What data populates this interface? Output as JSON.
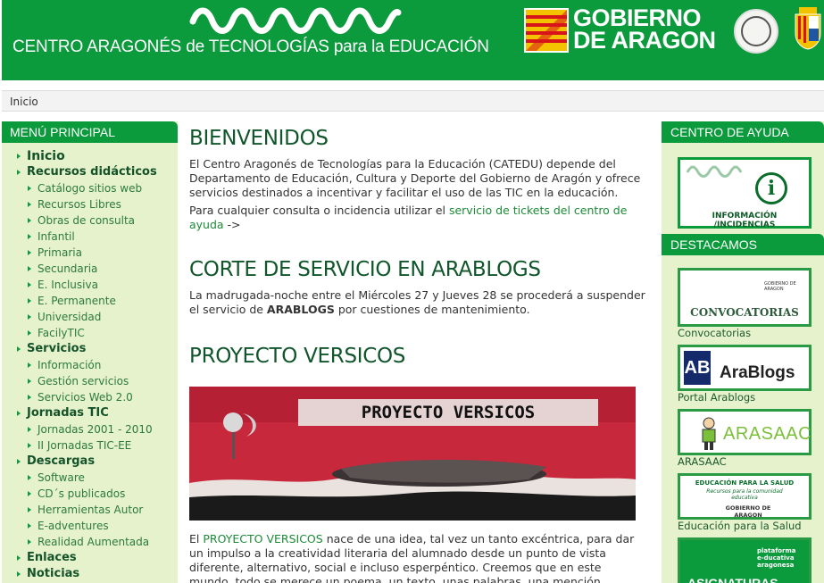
{
  "header": {
    "site_title": "CENTRO ARAGONÉS de TECNOLOGÍAS para la EDUCACIÓN",
    "gov_line1": "GOBIERNO",
    "gov_line2": "DE ARAGON"
  },
  "breadcrumb": "Inicio",
  "left_menu": {
    "title": "MENÚ PRINCIPAL",
    "items": [
      {
        "label": "Inicio",
        "level": "top"
      },
      {
        "label": "Recursos didácticos",
        "level": "top"
      },
      {
        "label": "Catálogo sitios web",
        "level": "sub"
      },
      {
        "label": "Recursos Libres",
        "level": "sub"
      },
      {
        "label": "Obras de consulta",
        "level": "sub"
      },
      {
        "label": "Infantil",
        "level": "sub"
      },
      {
        "label": "Primaria",
        "level": "sub"
      },
      {
        "label": "Secundaria",
        "level": "sub"
      },
      {
        "label": "E. Inclusiva",
        "level": "sub"
      },
      {
        "label": "E. Permanente",
        "level": "sub"
      },
      {
        "label": "Universidad",
        "level": "sub"
      },
      {
        "label": "FacilyTIC",
        "level": "sub"
      },
      {
        "label": "Servicios",
        "level": "top"
      },
      {
        "label": "Información",
        "level": "sub"
      },
      {
        "label": "Gestión servicios",
        "level": "sub"
      },
      {
        "label": "Servicios Web 2.0",
        "level": "sub"
      },
      {
        "label": "Jornadas TIC",
        "level": "top"
      },
      {
        "label": "Jornadas 2001 - 2010",
        "level": "sub"
      },
      {
        "label": "II Jornadas TIC-EE",
        "level": "sub"
      },
      {
        "label": "Descargas",
        "level": "top"
      },
      {
        "label": "Software",
        "level": "sub"
      },
      {
        "label": "CD´s publicados",
        "level": "sub"
      },
      {
        "label": "Herramientas Autor",
        "level": "sub"
      },
      {
        "label": "E-adventures",
        "level": "sub"
      },
      {
        "label": "Realidad Aumentada",
        "level": "sub"
      },
      {
        "label": "Enlaces",
        "level": "top"
      },
      {
        "label": "Noticias",
        "level": "top"
      }
    ]
  },
  "main": {
    "welcome": {
      "title": "BIENVENIDOS",
      "p1": "El Centro Aragonés de Tecnologías para la Educación (CATEDU) depende del Departamento de Educación, Cultura y Deporte del Gobierno de Aragón y ofrece servicios destinados a incentivar y facilitar el uso de las TIC en la educación.",
      "p2_pre": "Para cualquier consulta o incidencia utilizar el ",
      "p2_link": "servicio de tickets del centro de ayuda",
      "p2_post": " ->"
    },
    "arablogs": {
      "title": "CORTE DE SERVICIO EN ARABLOGS",
      "p_pre": "La madrugada-noche entre el Miércoles 27 y Jueves 28 se procederá a suspender el servicio de ",
      "p_bold": "ARABLOGS",
      "p_post": " por cuestiones de mantenimiento."
    },
    "versicos": {
      "title": "PROYECTO VERSICOS",
      "image_text": "PROYECTO VERSICOS",
      "link": "PROYECTO VERSICOS",
      "p_pre": "El ",
      "p_post": " nace de una idea, tal vez un tanto excéntrica, para dar un impulso a la creatividad literaria del alumnado desde un punto de vista diferente, alternativo, social e incluso esperpéntico. Creemos que en este mundo, todo se merece un poema, un texto, unas palabras, una mención..."
    }
  },
  "right": {
    "help_title": "CENTRO DE AYUDA",
    "help_box_text": "INFORMACIÓN /INCIDENCIAS",
    "featured_title": "DESTACAMOS",
    "items": [
      {
        "label": "Convocatorias",
        "banner": "CONVOCATORIAS",
        "small": "GOBIERNO DE ARAGON"
      },
      {
        "label": "Portal Arablogs",
        "banner": "AraBlogs",
        "small": "AB"
      },
      {
        "label": "ARASAAC",
        "banner": "ARASAAC",
        "small": ""
      },
      {
        "label": "Educación para la Salud",
        "banner": "EDUCACIÓN PARA LA SALUD",
        "small": "Recursos para la comunidad educativa",
        "small2": "GOBIERNO DE ARAGON"
      },
      {
        "label": "",
        "banner": "ASIGNATURAS",
        "small": "plataforma e-ducativa aragonesa"
      }
    ]
  }
}
